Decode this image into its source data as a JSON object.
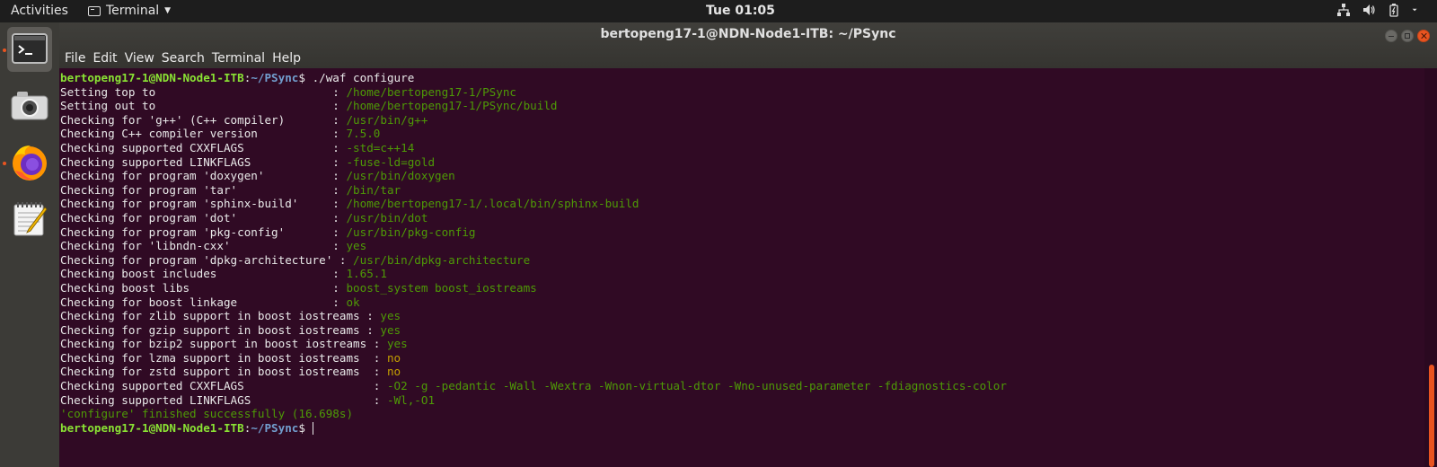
{
  "topbar": {
    "activities": "Activities",
    "app_name": "Terminal",
    "clock": "Tue 01:05",
    "tray_icons": [
      "network-icon",
      "volume-icon",
      "battery-icon",
      "menu-caret-icon"
    ]
  },
  "dock": {
    "items": [
      {
        "name": "terminal",
        "icon": "terminal-icon",
        "active": true
      },
      {
        "name": "screenshot",
        "icon": "camera-icon",
        "active": false
      },
      {
        "name": "firefox",
        "icon": "firefox-icon",
        "active": false
      },
      {
        "name": "text-editor",
        "icon": "text-editor-icon",
        "active": false
      }
    ]
  },
  "window": {
    "title": "bertopeng17-1@NDN-Node1-ITB: ~/PSync",
    "menu": [
      "File",
      "Edit",
      "View",
      "Search",
      "Terminal",
      "Help"
    ]
  },
  "terminal": {
    "prompt_user": "bertopeng17-1@NDN-Node1-ITB",
    "prompt_path": "~/PSync",
    "command": "./waf configure",
    "lines": [
      {
        "label": "Setting top to                          : ",
        "value": "/home/bertopeng17-1/PSync",
        "color": "green"
      },
      {
        "label": "Setting out to                          : ",
        "value": "/home/bertopeng17-1/PSync/build",
        "color": "green"
      },
      {
        "label": "Checking for 'g++' (C++ compiler)       : ",
        "value": "/usr/bin/g++",
        "color": "green"
      },
      {
        "label": "Checking C++ compiler version           : ",
        "value": "7.5.0",
        "color": "green"
      },
      {
        "label": "Checking supported CXXFLAGS             : ",
        "value": "-std=c++14",
        "color": "green"
      },
      {
        "label": "Checking supported LINKFLAGS            : ",
        "value": "-fuse-ld=gold",
        "color": "green"
      },
      {
        "label": "Checking for program 'doxygen'          : ",
        "value": "/usr/bin/doxygen",
        "color": "green"
      },
      {
        "label": "Checking for program 'tar'              : ",
        "value": "/bin/tar",
        "color": "green"
      },
      {
        "label": "Checking for program 'sphinx-build'     : ",
        "value": "/home/bertopeng17-1/.local/bin/sphinx-build",
        "color": "green"
      },
      {
        "label": "Checking for program 'dot'              : ",
        "value": "/usr/bin/dot",
        "color": "green"
      },
      {
        "label": "Checking for program 'pkg-config'       : ",
        "value": "/usr/bin/pkg-config",
        "color": "green"
      },
      {
        "label": "Checking for 'libndn-cxx'               : ",
        "value": "yes",
        "color": "green"
      },
      {
        "label": "Checking for program 'dpkg-architecture' : ",
        "value": "/usr/bin/dpkg-architecture",
        "color": "green"
      },
      {
        "label": "Checking boost includes                 : ",
        "value": "1.65.1",
        "color": "green"
      },
      {
        "label": "Checking boost libs                     : ",
        "value": "boost_system boost_iostreams",
        "color": "green"
      },
      {
        "label": "Checking for boost linkage              : ",
        "value": "ok",
        "color": "green"
      },
      {
        "label": "Checking for zlib support in boost iostreams : ",
        "value": "yes",
        "color": "green"
      },
      {
        "label": "Checking for gzip support in boost iostreams : ",
        "value": "yes",
        "color": "green"
      },
      {
        "label": "Checking for bzip2 support in boost iostreams : ",
        "value": "yes",
        "color": "green"
      },
      {
        "label": "Checking for lzma support in boost iostreams  : ",
        "value": "no",
        "color": "amber"
      },
      {
        "label": "Checking for zstd support in boost iostreams  : ",
        "value": "no",
        "color": "amber"
      },
      {
        "label": "Checking supported CXXFLAGS                   : ",
        "value": "-O2 -g -pedantic -Wall -Wextra -Wnon-virtual-dtor -Wno-unused-parameter -fdiagnostics-color",
        "color": "green"
      },
      {
        "label": "Checking supported LINKFLAGS                  : ",
        "value": "-Wl,-O1",
        "color": "green"
      },
      {
        "label": "",
        "value": "'configure' finished successfully (16.698s)",
        "color": "green"
      }
    ]
  },
  "colors": {
    "terminal_bg": "#300a24",
    "green": "#4e9a06",
    "amber": "#c4a000",
    "prompt_user": "#8ae234",
    "prompt_path": "#729fcf",
    "accent": "#e95420"
  }
}
